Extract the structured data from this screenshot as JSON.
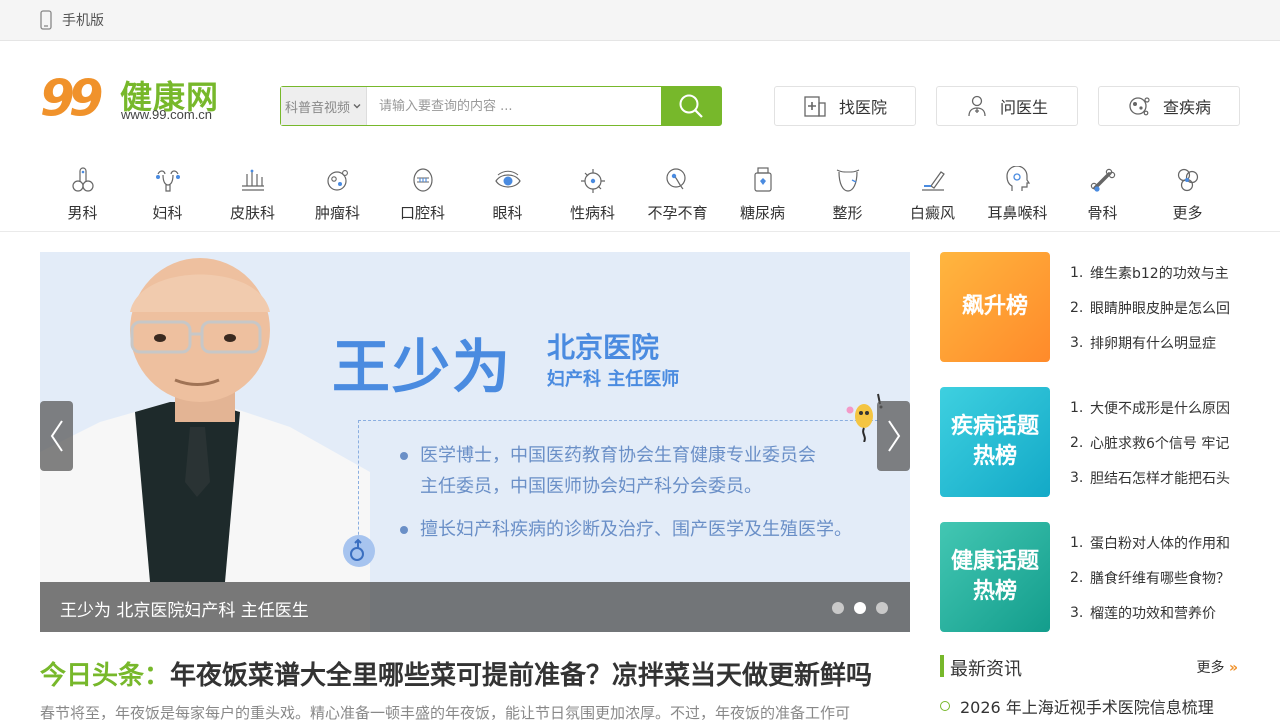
{
  "topbar": {
    "mobile_label": "手机版"
  },
  "logo": {
    "nums": "99",
    "brand": "健康网",
    "url": "www.99.com.cn"
  },
  "search": {
    "type_selected": "科普音视频",
    "placeholder": "请输入要查询的内容 ...",
    "search_icon": "search-icon"
  },
  "header_buttons": [
    {
      "label": "找医院",
      "icon": "hospital-icon"
    },
    {
      "label": "问医生",
      "icon": "doctor-icon"
    },
    {
      "label": "查疾病",
      "icon": "virus-icon"
    }
  ],
  "categories": [
    {
      "label": "男科",
      "icon": "male-organ-icon"
    },
    {
      "label": "妇科",
      "icon": "uterus-icon"
    },
    {
      "label": "皮肤科",
      "icon": "skin-hair-icon"
    },
    {
      "label": "肿瘤科",
      "icon": "tumor-cell-icon"
    },
    {
      "label": "口腔科",
      "icon": "mouth-icon"
    },
    {
      "label": "眼科",
      "icon": "eye-icon"
    },
    {
      "label": "性病科",
      "icon": "std-virus-icon"
    },
    {
      "label": "不孕不育",
      "icon": "fertility-icon"
    },
    {
      "label": "糖尿病",
      "icon": "insulin-bottle-icon"
    },
    {
      "label": "整形",
      "icon": "face-contour-icon"
    },
    {
      "label": "白癜风",
      "icon": "skin-pen-icon"
    },
    {
      "label": "耳鼻喉科",
      "icon": "head-ent-icon"
    },
    {
      "label": "骨科",
      "icon": "bone-icon"
    },
    {
      "label": "更多",
      "icon": "more-cluster-icon"
    }
  ],
  "banner": {
    "doctor_name": "王少为",
    "hospital": "北京医院",
    "dept_title": "妇产科 主任医师",
    "bullet_1_line_1": "医学博士，中国医药教育协会生育健康专业委员会",
    "bullet_1_line_2": "主任委员，中国医师协会妇产科分会委员。",
    "bullet_2": "擅长妇产科疾病的诊断及治疗、围产医学及生殖医学。",
    "caption": "王少为 北京医院妇产科 主任医生",
    "slide_count": 3,
    "active_slide": 2
  },
  "headline": {
    "tag": "今日头条：",
    "title": "年夜饭菜谱大全里哪些菜可提前准备？凉拌菜当天做更新鲜吗",
    "summary": "春节将至，年夜饭是每家每户的重头戏。精心准备一顿丰盛的年夜饭，能让节日氛围更加浓厚。不过，年夜饭的准备工作可"
  },
  "ranks": [
    {
      "box": "飙升榜",
      "style": "orange",
      "items": [
        "维生素b12的功效与主",
        "眼睛肿眼皮肿是怎么回",
        "排卵期有什么明显症"
      ]
    },
    {
      "box_line_1": "疾病话题",
      "box_line_2": "热榜",
      "style": "teal",
      "items": [
        "大便不成形是什么原因",
        "心脏求救6个信号 牢记",
        "胆结石怎样才能把石头"
      ]
    },
    {
      "box_line_1": "健康话题",
      "box_line_2": "热榜",
      "style": "green",
      "items": [
        "蛋白粉对人体的作用和",
        "膳食纤维有哪些食物？",
        "榴莲的功效和营养价"
      ]
    }
  ],
  "news": {
    "title": "最新资讯",
    "more": "更多",
    "more_icon": "double-chevron-right-icon",
    "first_item": "2026 年上海近视手术医院信息梳理"
  },
  "colors": {
    "brand_green": "#77b82b",
    "brand_orange": "#f0922b",
    "banner_blue": "#4a8be0"
  }
}
